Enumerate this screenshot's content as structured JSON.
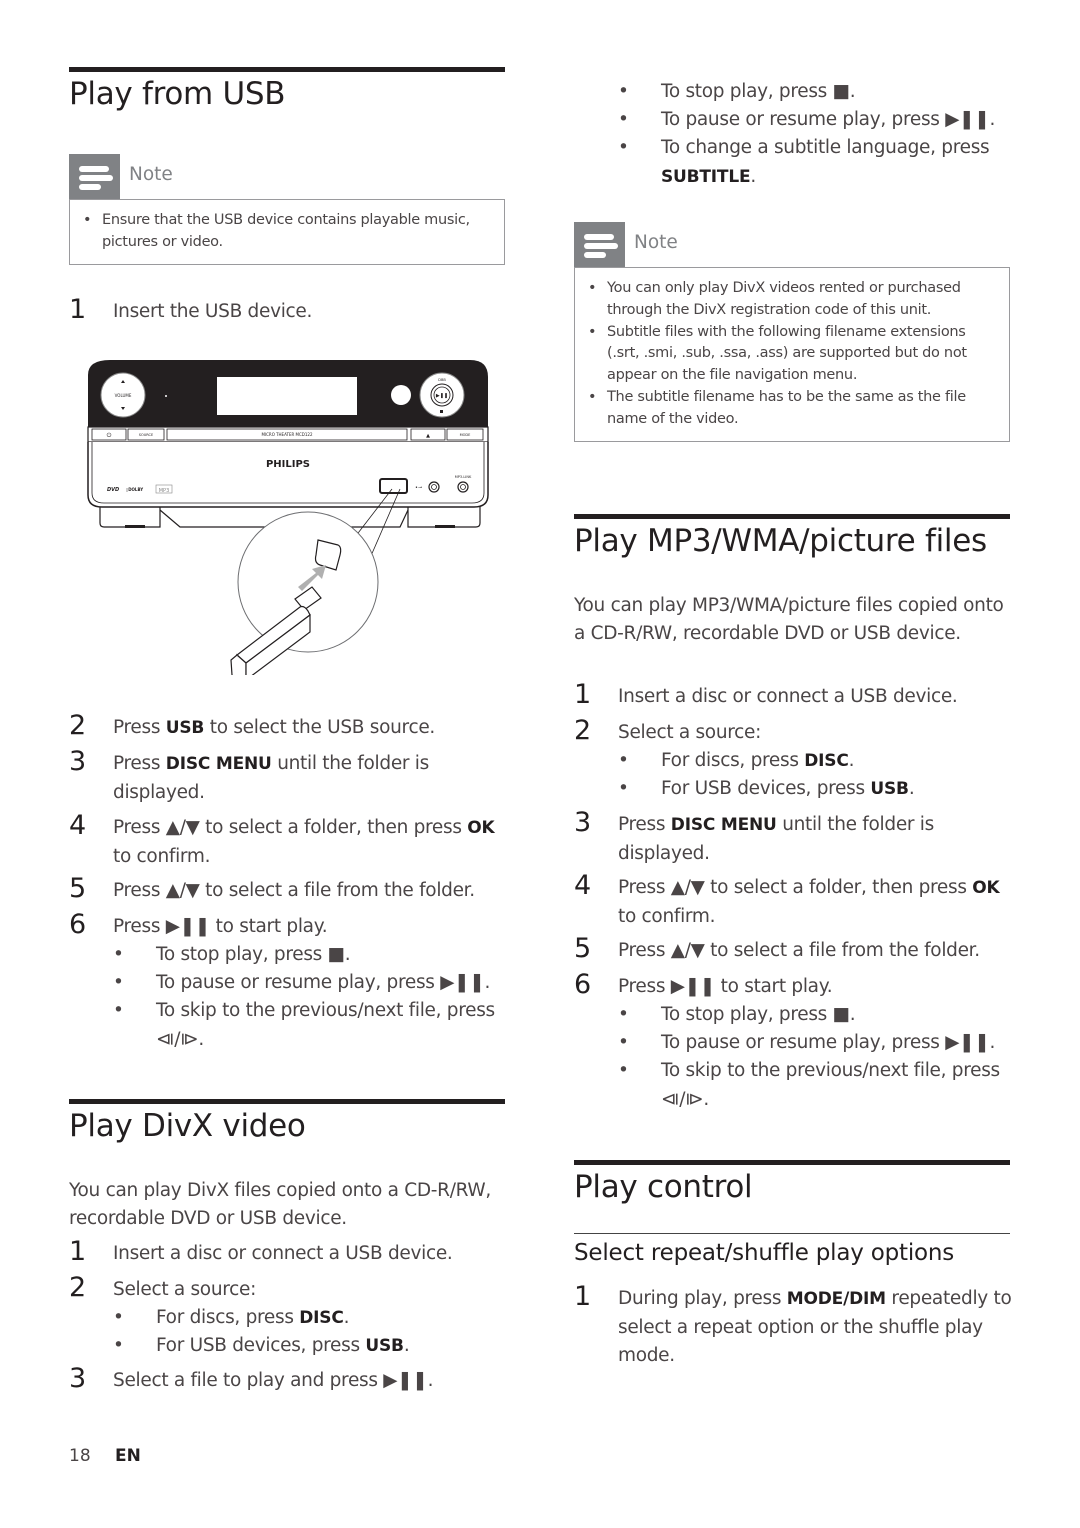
{
  "page": {
    "number": "18",
    "language": "EN"
  },
  "left_column": {
    "usb_section": {
      "title": "Play from USB",
      "note": {
        "label": "Note",
        "items": [
          "Ensure that the USB device contains playable music, pictures or video."
        ]
      },
      "step1": {
        "num": "1",
        "text": "Insert the USB device."
      },
      "illustration": {
        "device_brand": "PHILIPS",
        "device_model_label": "MICRO THEATER MCD122",
        "buttons": [
          "VOLUME",
          "SOURCE",
          "MODE",
          "DBB",
          "MP3-LINK"
        ],
        "logos": [
          "DVD",
          "DOLBY DIGITAL",
          "MP3"
        ]
      },
      "steps": [
        {
          "num": "2",
          "pre": "Press ",
          "kw": "USB",
          "post": " to select the USB source."
        },
        {
          "num": "3",
          "pre": "Press ",
          "kw": "DISC MENU",
          "post": " until the folder is displayed."
        },
        {
          "num": "4",
          "pre": "Press ▲/▼ to select a folder, then press ",
          "kw": "OK",
          "post": " to confirm."
        },
        {
          "num": "5",
          "pre": "Press ▲/▼ to select a file from the folder.",
          "kw": "",
          "post": ""
        },
        {
          "num": "6",
          "pre": "Press ▶❚❚ to start play.",
          "kw": "",
          "post": ""
        }
      ],
      "bullets": [
        "To stop play, press ■.",
        "To pause or resume play, press ▶❚❚.",
        "To skip to the previous/next file, press ⧏/⧐."
      ]
    },
    "divx_section": {
      "title": "Play DivX video",
      "intro": "You can play DivX files copied onto a CD-R/RW, recordable DVD or USB device.",
      "steps": [
        {
          "num": "1",
          "text": "Insert a disc or connect a USB device."
        },
        {
          "num": "2",
          "text": "Select a source:"
        },
        {
          "num": "3",
          "text": "Select a file to play and press ▶❚❚."
        }
      ],
      "bullets": [
        {
          "pre": "For discs, press ",
          "kw": "DISC",
          "post": "."
        },
        {
          "pre": "For USB devices, press ",
          "kw": "USB",
          "post": "."
        }
      ]
    }
  },
  "right_column": {
    "divx_continued": {
      "bullets": [
        {
          "pre": "To stop play, press ■.",
          "kw": "",
          "post": ""
        },
        {
          "pre": "To pause or resume play, press ▶❚❚.",
          "kw": "",
          "post": ""
        },
        {
          "pre": "To change a subtitle language, press ",
          "kw": "SUBTITLE",
          "post": "."
        }
      ],
      "note": {
        "label": "Note",
        "items": [
          "You can only play DivX videos rented or purchased through the DivX registration code of this unit.",
          "Subtitle files with the following filename extensions (.srt, .smi, .sub, .ssa, .ass) are supported but do not appear on the file navigation menu.",
          "The subtitle filename has to be the same as the file name of the video."
        ]
      }
    },
    "mp3_section": {
      "title": "Play MP3/WMA/picture files",
      "intro": "You can play MP3/WMA/picture files copied onto a CD-R/RW, recordable DVD or USB device.",
      "steps": [
        {
          "num": "1",
          "pre": "Insert a disc or connect a USB device.",
          "kw": "",
          "post": ""
        },
        {
          "num": "2",
          "pre": "Select a source:",
          "kw": "",
          "post": ""
        },
        {
          "num": "3",
          "pre": "Press ",
          "kw": "DISC MENU",
          "post": " until the folder is displayed."
        },
        {
          "num": "4",
          "pre": "Press ▲/▼ to select a folder, then press ",
          "kw": "OK",
          "post": " to confirm."
        },
        {
          "num": "5",
          "pre": "Press ▲/▼ to select a file from the folder.",
          "kw": "",
          "post": ""
        },
        {
          "num": "6",
          "pre": "Press ▶❚❚ to start play.",
          "kw": "",
          "post": ""
        }
      ],
      "source_bullets": [
        {
          "pre": "For discs, press ",
          "kw": "DISC",
          "post": "."
        },
        {
          "pre": "For USB devices, press ",
          "kw": "USB",
          "post": "."
        }
      ],
      "play_bullets": [
        "To stop play, press ■.",
        "To pause or resume play, press ▶❚❚.",
        "To skip to the previous/next file, press ⧏/⧐."
      ]
    },
    "play_control_section": {
      "title": "Play control",
      "subtitle": "Select repeat/shuffle play options",
      "step": {
        "num": "1",
        "pre": "During play, press ",
        "kw": "MODE/DIM",
        "post": " repeatedly to select a repeat option or the shuffle play mode."
      }
    }
  }
}
